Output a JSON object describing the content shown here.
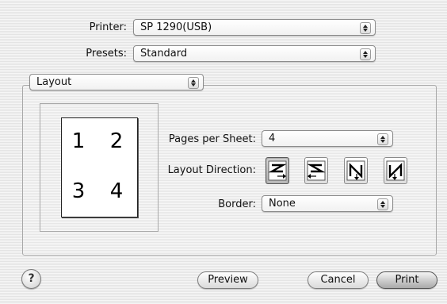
{
  "printer": {
    "label": "Printer:",
    "value": "SP 1290(USB)"
  },
  "presets": {
    "label": "Presets:",
    "value": "Standard"
  },
  "pane_select": {
    "value": "Layout"
  },
  "layout": {
    "preview_numbers": [
      "1",
      "2",
      "3",
      "4"
    ],
    "pages_per_sheet": {
      "label": "Pages per Sheet:",
      "value": "4"
    },
    "layout_direction": {
      "label": "Layout Direction:",
      "options": [
        "left-to-right-then-down",
        "right-to-left-then-down",
        "top-to-bottom-then-right",
        "top-to-bottom-then-left"
      ],
      "selected_index": 0
    },
    "border": {
      "label": "Border:",
      "value": "None"
    }
  },
  "buttons": {
    "help": "?",
    "preview": "Preview",
    "cancel": "Cancel",
    "print": "Print"
  },
  "icons": {
    "popup_arrows": "up-down-arrows-icon",
    "help": "question-mark-icon"
  }
}
